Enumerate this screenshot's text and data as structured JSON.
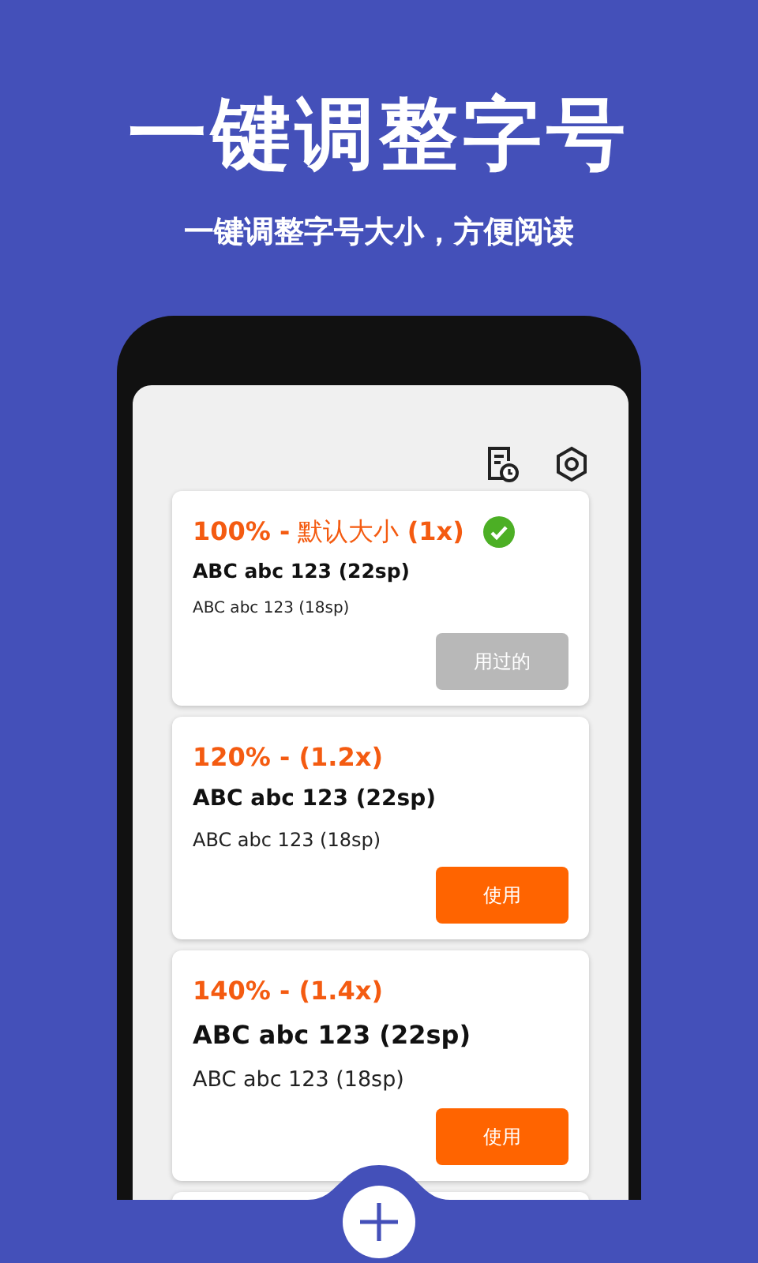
{
  "headline": "一键调整字号",
  "subtitle": "一键调整字号大小，方便阅读",
  "options": [
    {
      "title": "**100% -** 默认大小 **(1x)**",
      "sample_large": "ABC abc 123 (22sp)",
      "sample_small": "ABC abc 123 (18sp)",
      "button": "用过的",
      "selected": true
    },
    {
      "title": "**120% - (1.2x)**",
      "sample_large": "ABC abc 123 (22sp)",
      "sample_small": "ABC abc 123 (18sp)",
      "button": "使用",
      "selected": false
    },
    {
      "title": "**140% - (1.4x)**",
      "sample_large": "ABC abc 123 (22sp)",
      "sample_small": "ABC abc 123 (18sp)",
      "button": "使用",
      "selected": false
    }
  ]
}
